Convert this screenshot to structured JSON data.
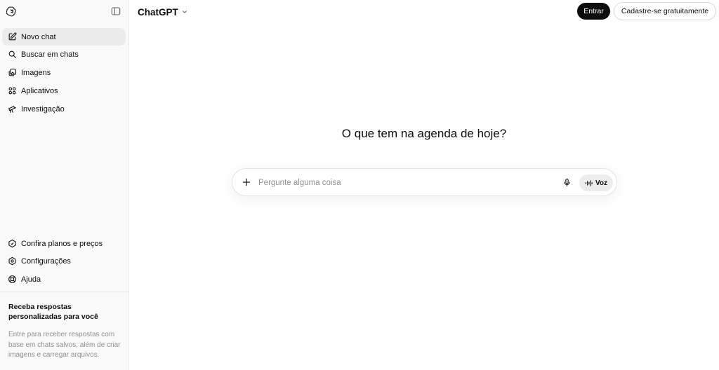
{
  "sidebar": {
    "items": [
      {
        "label": "Novo chat",
        "icon": "edit-icon"
      },
      {
        "label": "Buscar em chats",
        "icon": "search-icon"
      },
      {
        "label": "Imagens",
        "icon": "images-icon"
      },
      {
        "label": "Aplicativos",
        "icon": "apps-icon"
      },
      {
        "label": "Investigação",
        "icon": "telescope-icon"
      }
    ],
    "bottom_items": [
      {
        "label": "Confira planos e preços",
        "icon": "plans-icon"
      },
      {
        "label": "Configurações",
        "icon": "gear-icon"
      },
      {
        "label": "Ajuda",
        "icon": "help-icon"
      }
    ],
    "promo": {
      "title": "Receba respostas personalizadas para você",
      "text": "Entre para receber respostas com base em chats salvos, além de criar imagens e carregar arquivos."
    }
  },
  "header": {
    "title": "ChatGPT",
    "login_label": "Entrar",
    "signup_label": "Cadastre-se gratuitamente"
  },
  "main": {
    "headline": "O que tem na agenda de hoje?",
    "composer": {
      "placeholder": "Pergunte alguma coisa",
      "voice_label": "Voz"
    }
  },
  "colors": {
    "accent": "#0d0d0d",
    "sidebar_bg": "#f9f9f9",
    "active_item": "#ececec",
    "muted_text": "#8f8f8f"
  }
}
